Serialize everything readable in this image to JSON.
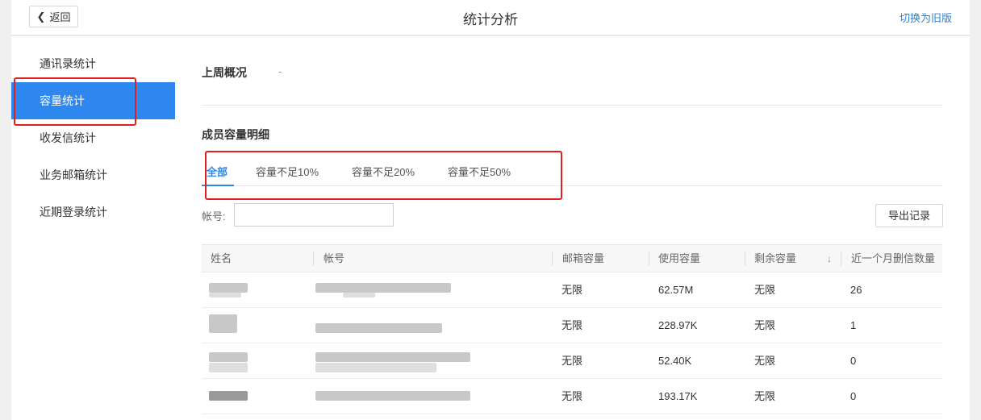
{
  "header": {
    "back_label": "返回",
    "title": "统计分析",
    "switch_link": "切换为旧版"
  },
  "sidebar": {
    "items": [
      {
        "label": "通讯录统计",
        "active": false
      },
      {
        "label": "容量统计",
        "active": true
      },
      {
        "label": "收发信统计",
        "active": false
      },
      {
        "label": "业务邮箱统计",
        "active": false
      },
      {
        "label": "近期登录统计",
        "active": false
      }
    ]
  },
  "overview": {
    "title": "上周概况",
    "value": "-"
  },
  "detail": {
    "title": "成员容量明细",
    "tabs": [
      "全部",
      "容量不足10%",
      "容量不足20%",
      "容量不足50%"
    ],
    "active_tab": "全部",
    "account_label": "帐号:",
    "account_value": "",
    "export_label": "导出记录"
  },
  "table": {
    "columns": [
      "姓名",
      "帐号",
      "邮箱容量",
      "使用容量",
      "剩余容量",
      "近一个月删信数量"
    ],
    "sort_icon": "arrow-down-icon",
    "rows": [
      {
        "mailbox": "无限",
        "used": "62.57M",
        "remaining": "无限",
        "deleted": "26"
      },
      {
        "mailbox": "无限",
        "used": "228.97K",
        "remaining": "无限",
        "deleted": "1"
      },
      {
        "mailbox": "无限",
        "used": "52.40K",
        "remaining": "无限",
        "deleted": "0"
      },
      {
        "mailbox": "无限",
        "used": "193.17K",
        "remaining": "无限",
        "deleted": "0"
      }
    ]
  },
  "colors": {
    "accent": "#2d87ee",
    "highlight": "#e02020",
    "link": "#2b7fd6"
  }
}
